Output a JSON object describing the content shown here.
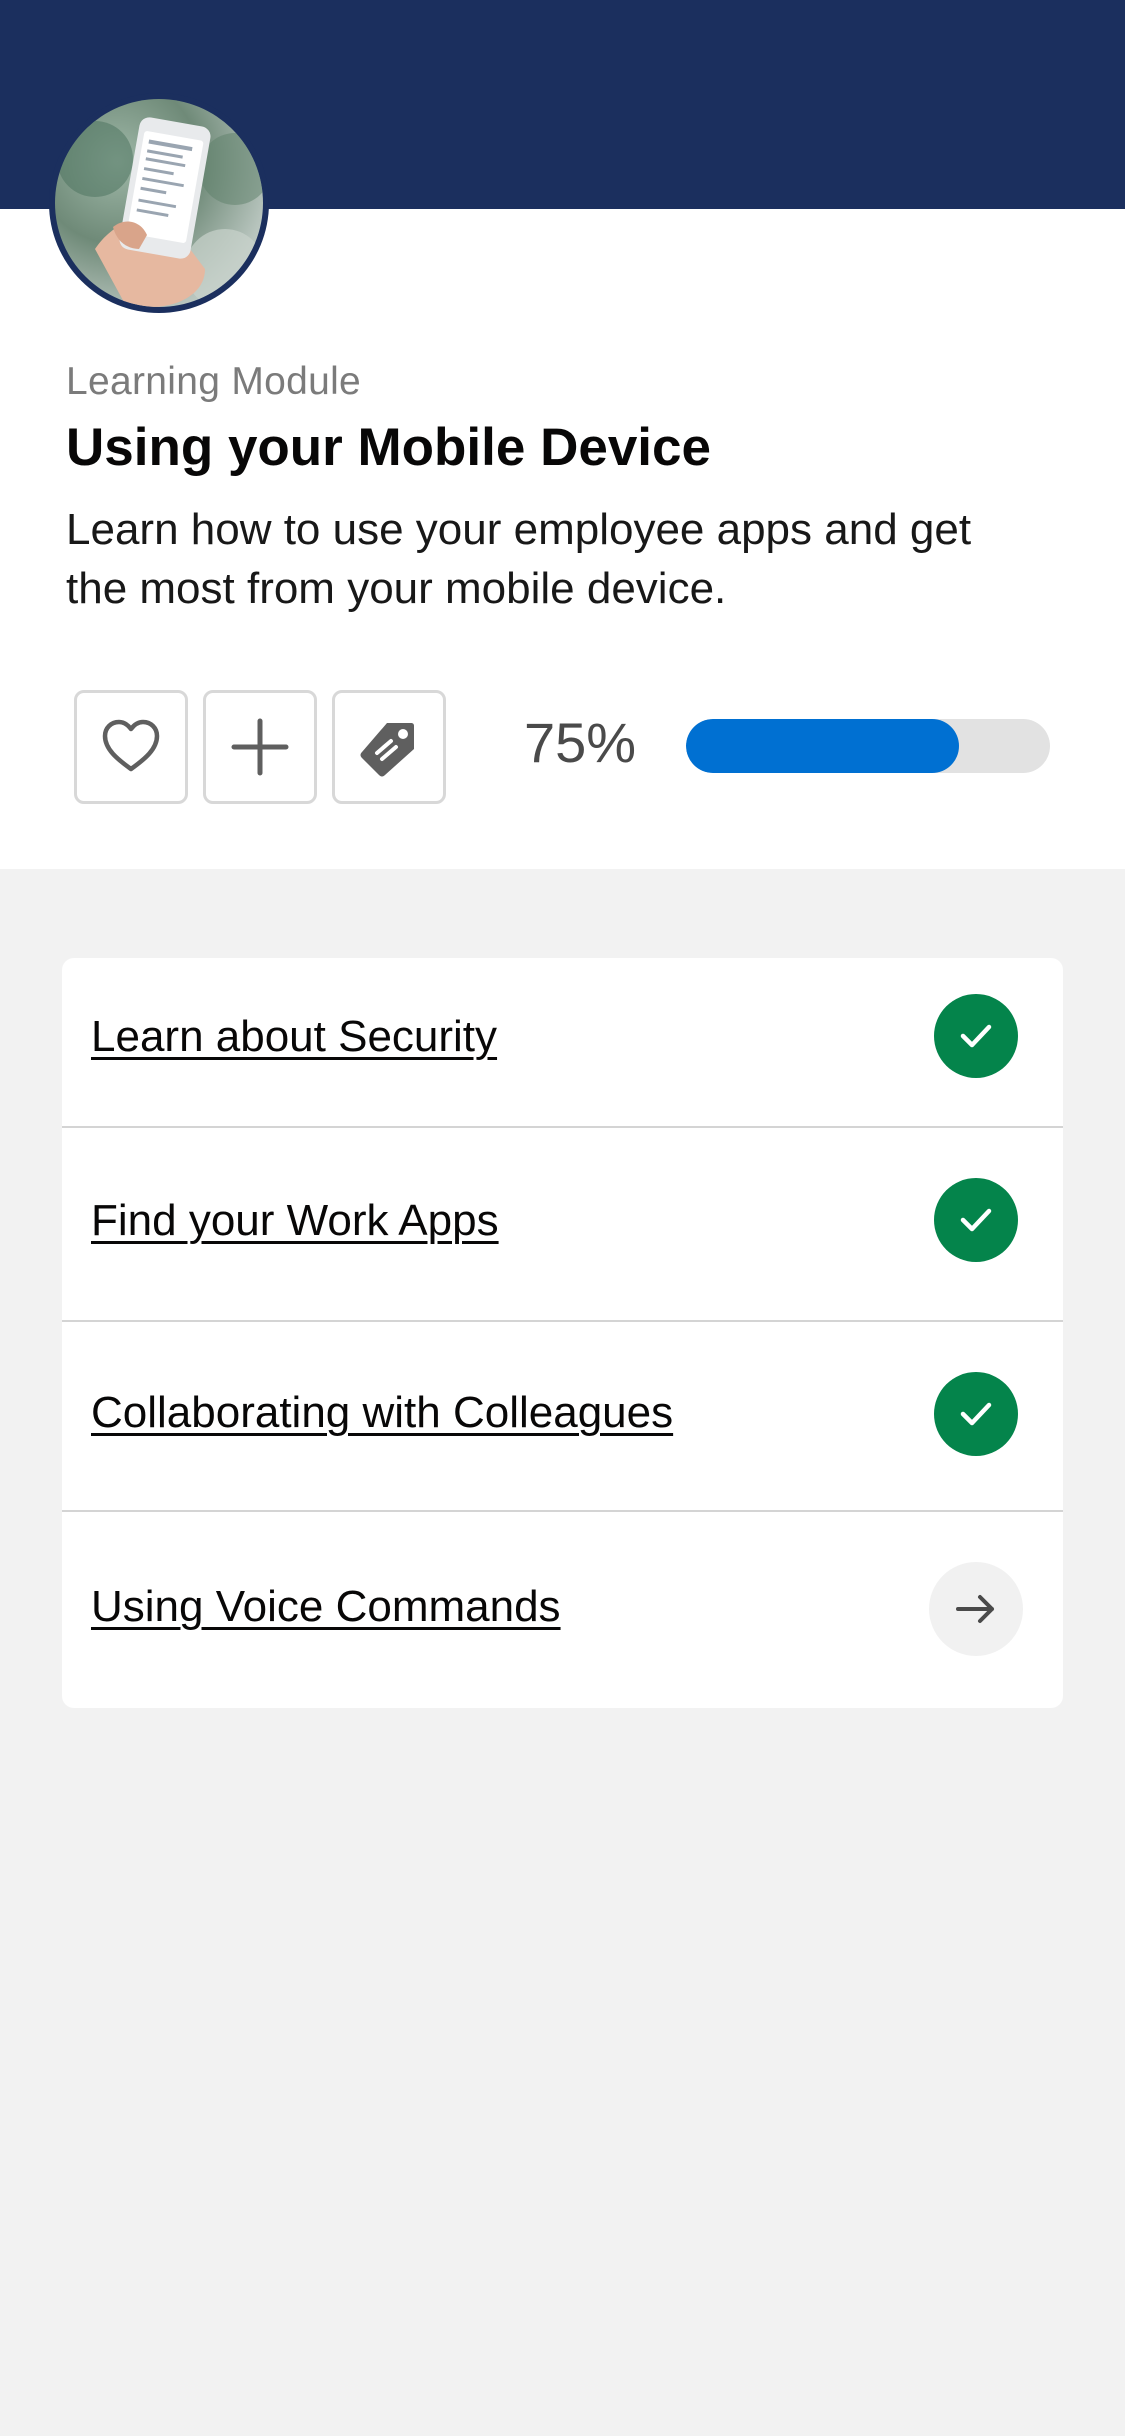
{
  "module": {
    "eyebrow": "Learning Module",
    "title": "Using your Mobile Device",
    "description": "Learn how to use your employee apps and get the most from your mobile device.",
    "image_icon": "phone-in-hand-photo"
  },
  "actions": [
    {
      "icon": "heart-icon"
    },
    {
      "icon": "plus-icon"
    },
    {
      "icon": "tag-icon"
    }
  ],
  "progress": {
    "label": "75%",
    "value": 0.75
  },
  "units": [
    {
      "label": "Learn about Security",
      "status": "complete",
      "icon": "check-icon"
    },
    {
      "label": "Find your Work Apps",
      "status": "complete",
      "icon": "check-icon"
    },
    {
      "label": "Collaborating with Colleagues",
      "status": "complete",
      "icon": "check-icon"
    },
    {
      "label": "Using Voice Commands",
      "status": "next",
      "icon": "arrow-right-icon"
    }
  ],
  "colors": {
    "header": "#1b2f5e",
    "progress_fill": "#0070d2",
    "progress_track": "#e2e2e2",
    "complete": "#04844b",
    "background": "#f2f2f2"
  }
}
